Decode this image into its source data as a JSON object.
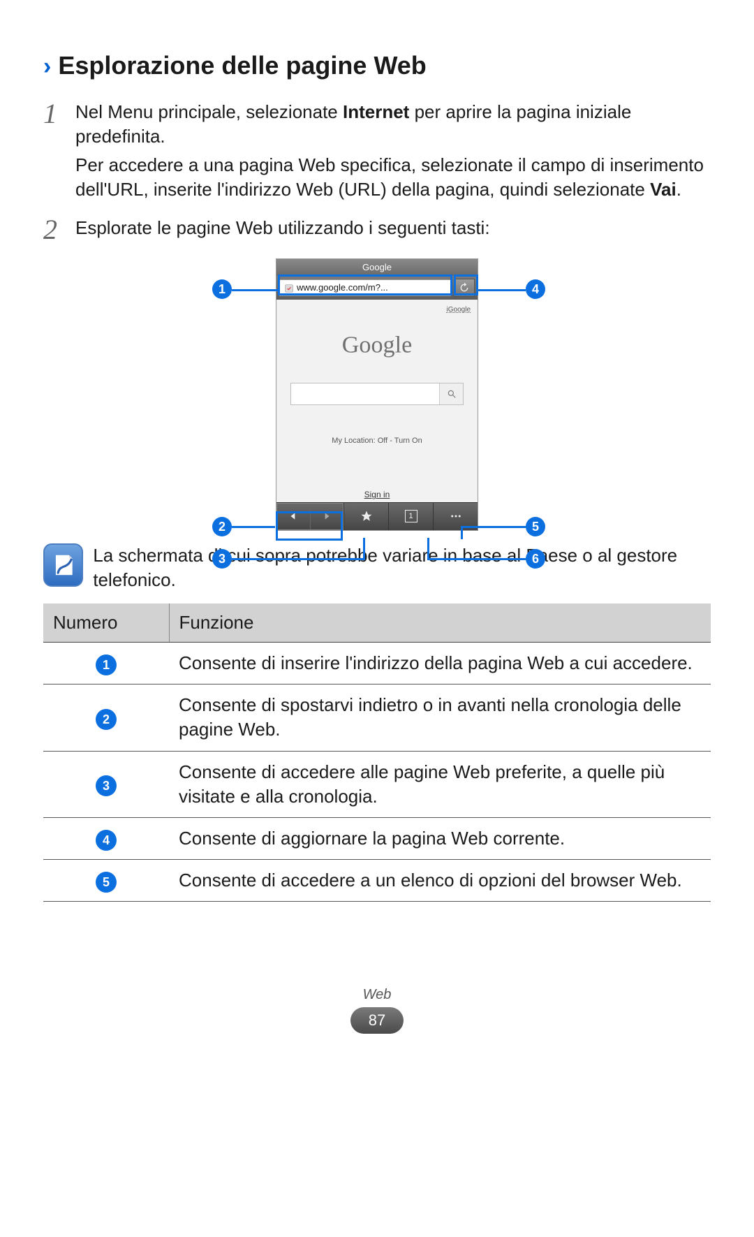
{
  "heading": "Esplorazione delle pagine Web",
  "steps": [
    {
      "num": "1",
      "para1_a": "Nel Menu principale, selezionate ",
      "para1_bold": "Internet",
      "para1_b": " per aprire la pagina iniziale predefinita.",
      "para2_a": "Per accedere a una pagina Web specifica, selezionate il campo di inserimento dell'URL, inserite l'indirizzo Web (URL) della pagina, quindi selezionate ",
      "para2_bold": "Vai",
      "para2_b": "."
    },
    {
      "num": "2",
      "text": "Esplorate le pagine Web utilizzando i seguenti tasti:"
    }
  ],
  "phone": {
    "titlebar": "Google",
    "url": "www.google.com/m?...",
    "google_label": "iGoogle",
    "location_text": "My Location: Off - Turn On",
    "signin": "Sign in",
    "tab_count": "1",
    "callouts": [
      "1",
      "2",
      "3",
      "4",
      "5",
      "6"
    ]
  },
  "note": "La schermata di cui sopra potrebbe variare in base al Paese o al gestore telefonico.",
  "table": {
    "head": [
      "Numero",
      "Funzione"
    ],
    "rows": [
      {
        "n": "1",
        "text": "Consente di inserire l'indirizzo della pagina Web a cui accedere."
      },
      {
        "n": "2",
        "text": "Consente di spostarvi indietro o in avanti nella cronologia delle pagine Web."
      },
      {
        "n": "3",
        "text": "Consente di accedere alle pagine Web preferite, a quelle più visitate e alla cronologia."
      },
      {
        "n": "4",
        "text": "Consente di aggiornare la pagina Web corrente."
      },
      {
        "n": "5",
        "text": "Consente di accedere a un elenco di opzioni del browser Web."
      }
    ]
  },
  "footer": {
    "section": "Web",
    "page": "87"
  }
}
